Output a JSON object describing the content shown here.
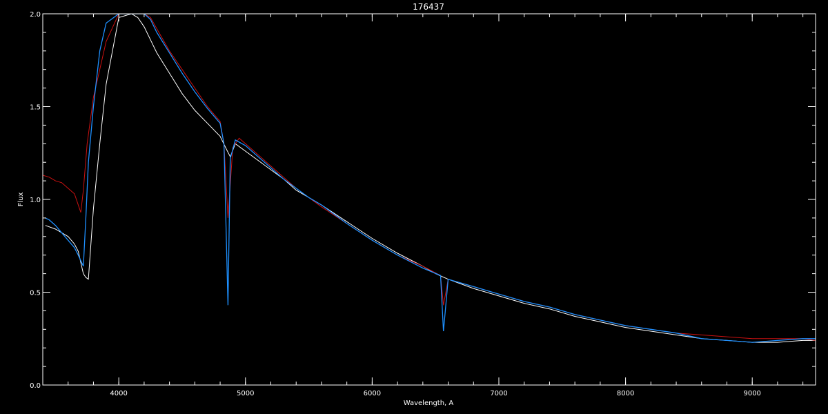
{
  "chart_data": {
    "type": "line",
    "title": "176437",
    "xlabel": "Wavelength, A",
    "ylabel": "Flux",
    "xlim": [
      3400,
      9500
    ],
    "ylim": [
      0.0,
      2.0
    ],
    "x_ticks": [
      4000,
      5000,
      6000,
      7000,
      8000,
      9000
    ],
    "x_tick_labels": [
      "4000",
      "5000",
      "6000",
      "7000",
      "8000",
      "9000"
    ],
    "y_ticks": [
      0.0,
      0.5,
      1.0,
      1.5,
      2.0
    ],
    "y_tick_labels": [
      "0.0",
      "0.5",
      "1.0",
      "1.5",
      "2.0"
    ],
    "grid": false,
    "colors": {
      "background": "#000000",
      "axes": "#ffffff",
      "observed": "#ffffff",
      "model": "#cc1111",
      "fit": "#1e90ff"
    },
    "series": [
      {
        "color": "#ffffff",
        "x": [
          3420,
          3500,
          3600,
          3650,
          3680,
          3700,
          3720,
          3740,
          3760,
          3800,
          3850,
          3900,
          4000,
          4100,
          4150,
          4200,
          4250,
          4300,
          4400,
          4500,
          4600,
          4700,
          4800,
          4850,
          4880,
          4920,
          5000,
          5100,
          5200,
          5300,
          5400,
          5500,
          5600,
          5800,
          6000,
          6200,
          6400,
          6500,
          6600,
          6800,
          7000,
          7200,
          7400,
          7600,
          7800,
          8000,
          8200,
          8400,
          8600,
          8800,
          9000,
          9200,
          9400,
          9500
        ],
        "y": [
          0.86,
          0.84,
          0.8,
          0.76,
          0.72,
          0.66,
          0.6,
          0.58,
          0.57,
          0.95,
          1.3,
          1.62,
          1.98,
          2.0,
          1.98,
          1.93,
          1.86,
          1.79,
          1.68,
          1.57,
          1.48,
          1.41,
          1.34,
          1.27,
          1.23,
          1.3,
          1.26,
          1.21,
          1.16,
          1.11,
          1.05,
          1.01,
          0.97,
          0.88,
          0.79,
          0.71,
          0.64,
          0.6,
          0.57,
          0.52,
          0.48,
          0.44,
          0.41,
          0.37,
          0.34,
          0.31,
          0.29,
          0.27,
          0.25,
          0.24,
          0.23,
          0.23,
          0.24,
          0.24
        ]
      },
      {
        "color": "#cc1111",
        "x": [
          3400,
          3450,
          3500,
          3550,
          3600,
          3650,
          3700,
          3720,
          3750,
          3800,
          3900,
          4000,
          4100,
          4200,
          4250,
          4300,
          4400,
          4500,
          4600,
          4700,
          4800,
          4830,
          4862,
          4900,
          4950,
          5000,
          5100,
          5200,
          5300,
          5400,
          5600,
          5800,
          6000,
          6200,
          6400,
          6540,
          6563,
          6600,
          6800,
          7000,
          7200,
          7400,
          7600,
          7800,
          8000,
          8200,
          8400,
          8600,
          8800,
          9000,
          9200,
          9400,
          9500
        ],
        "y": [
          1.13,
          1.12,
          1.1,
          1.09,
          1.06,
          1.03,
          0.93,
          1.05,
          1.3,
          1.55,
          1.85,
          2.0,
          2.0,
          2.0,
          1.98,
          1.92,
          1.8,
          1.7,
          1.6,
          1.5,
          1.42,
          1.3,
          0.9,
          1.28,
          1.33,
          1.3,
          1.24,
          1.18,
          1.12,
          1.06,
          0.96,
          0.87,
          0.78,
          0.7,
          0.64,
          0.59,
          0.43,
          0.57,
          0.53,
          0.49,
          0.45,
          0.42,
          0.38,
          0.35,
          0.32,
          0.3,
          0.28,
          0.27,
          0.26,
          0.25,
          0.25,
          0.25,
          0.24
        ]
      },
      {
        "color": "#1e90ff",
        "x": [
          3420,
          3450,
          3500,
          3550,
          3600,
          3650,
          3680,
          3700,
          3720,
          3740,
          3760,
          3800,
          3850,
          3900,
          4000,
          4100,
          4150,
          4200,
          4250,
          4300,
          4400,
          4500,
          4600,
          4700,
          4800,
          4830,
          4862,
          4880,
          4920,
          5000,
          5100,
          5200,
          5300,
          5400,
          5500,
          5600,
          5800,
          6000,
          6200,
          6400,
          6540,
          6563,
          6600,
          6800,
          7000,
          7200,
          7400,
          7600,
          7800,
          8000,
          8200,
          8400,
          8600,
          8800,
          9000,
          9200,
          9400,
          9500
        ],
        "y": [
          0.9,
          0.89,
          0.86,
          0.82,
          0.78,
          0.74,
          0.7,
          0.67,
          0.64,
          0.9,
          1.2,
          1.5,
          1.8,
          1.95,
          2.0,
          2.0,
          2.0,
          2.0,
          1.97,
          1.9,
          1.79,
          1.68,
          1.58,
          1.49,
          1.41,
          1.3,
          0.43,
          1.22,
          1.32,
          1.29,
          1.23,
          1.17,
          1.11,
          1.06,
          1.01,
          0.97,
          0.87,
          0.78,
          0.7,
          0.63,
          0.59,
          0.29,
          0.57,
          0.53,
          0.49,
          0.45,
          0.42,
          0.38,
          0.35,
          0.32,
          0.3,
          0.28,
          0.25,
          0.24,
          0.23,
          0.24,
          0.25,
          0.25
        ]
      }
    ]
  }
}
